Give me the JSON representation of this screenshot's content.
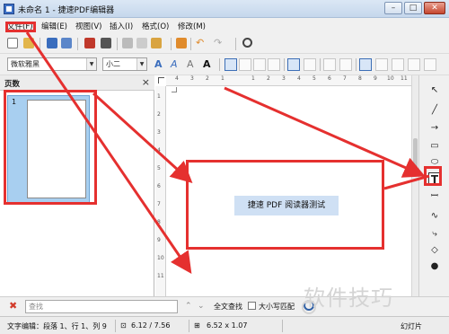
{
  "window": {
    "title": "未命名 1 - 捷速PDF编辑器"
  },
  "menu": [
    {
      "label": "文件(F)"
    },
    {
      "label": "编辑(E)"
    },
    {
      "label": "视图(V)"
    },
    {
      "label": "插入(I)"
    },
    {
      "label": "格式(O)"
    },
    {
      "label": "修改(M)"
    }
  ],
  "toolbar2": {
    "font_family": "微软雅黑",
    "font_size": "小二"
  },
  "left_panel": {
    "title": "页数",
    "close": "×",
    "thumb_number": "1"
  },
  "ruler": {
    "h_ticks": [
      "4",
      "3",
      "2",
      "1",
      "1",
      "2",
      "3",
      "4",
      "5",
      "6",
      "7",
      "8",
      "9",
      "10",
      "11",
      "12"
    ],
    "v_ticks": [
      "1",
      "2",
      "3",
      "4",
      "5",
      "6",
      "7",
      "8",
      "9",
      "10",
      "11"
    ]
  },
  "canvas": {
    "textbox_text": "捷速 PDF 阅读器测试"
  },
  "find_bar": {
    "placeholder": "查找",
    "full_text_label": "全文查找",
    "match_case_label": "大小写匹配"
  },
  "status": {
    "mode": "文字编辑：段落 1、行 1、列 9",
    "position": "6.12 / 7.56",
    "size": "6.52 x 1.07",
    "view": "幻灯片"
  },
  "watermark": "软件技巧",
  "annotation_color": "#e5302f"
}
